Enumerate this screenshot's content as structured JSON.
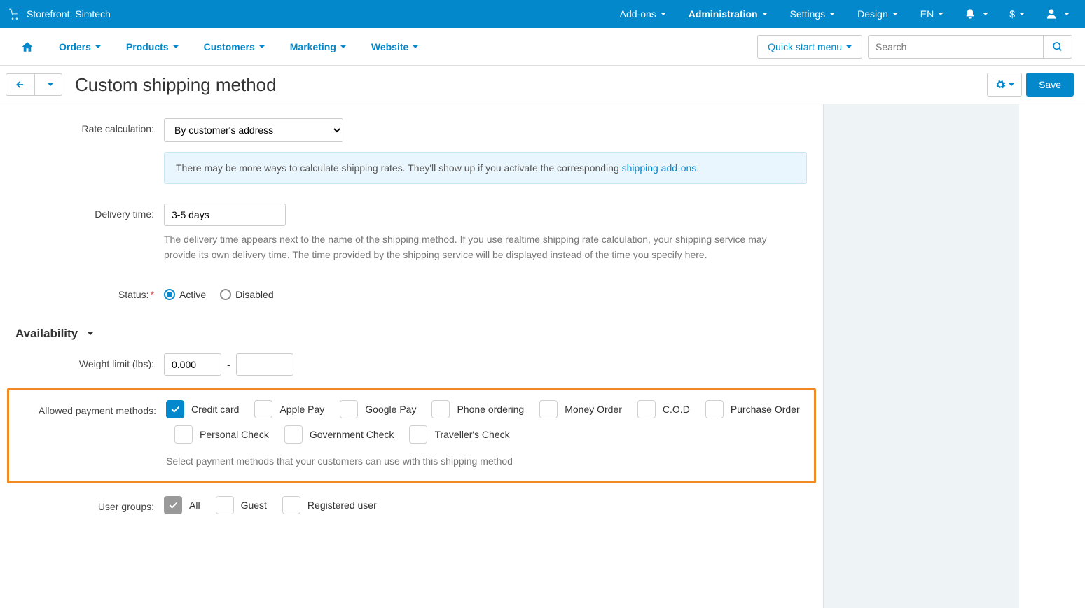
{
  "topbar": {
    "storefront": "Storefront: Simtech",
    "menu": [
      "Add-ons",
      "Administration",
      "Settings",
      "Design",
      "EN",
      "$"
    ]
  },
  "mainnav": {
    "items": [
      "Orders",
      "Products",
      "Customers",
      "Marketing",
      "Website"
    ],
    "quick_menu": "Quick start menu",
    "search_placeholder": "Search"
  },
  "page": {
    "title": "Custom shipping method",
    "save": "Save"
  },
  "form": {
    "rate_calc": {
      "label": "Rate calculation:",
      "value": "By customer's address",
      "info_prefix": "There may be more ways to calculate shipping rates. They'll show up if you activate the corresponding ",
      "info_link": "shipping add-ons",
      "info_suffix": "."
    },
    "delivery_time": {
      "label": "Delivery time:",
      "value": "3-5 days",
      "hint": "The delivery time appears next to the name of the shipping method. If you use realtime shipping rate calculation, your shipping service may provide its own delivery time. The time provided by the shipping service will be displayed instead of the time you specify here."
    },
    "status": {
      "label": "Status:",
      "active": "Active",
      "disabled": "Disabled"
    },
    "availability": "Availability",
    "weight_limit": {
      "label": "Weight limit (lbs):",
      "from": "0.000",
      "sep": "-",
      "to": ""
    },
    "payment_methods": {
      "label": "Allowed payment methods:",
      "options": [
        "Credit card",
        "Apple Pay",
        "Google Pay",
        "Phone ordering",
        "Money Order",
        "C.O.D",
        "Purchase Order",
        "Personal Check",
        "Government Check",
        "Traveller's Check"
      ],
      "hint": "Select payment methods that your customers can use with this shipping method"
    },
    "user_groups": {
      "label": "User groups:",
      "options": [
        "All",
        "Guest",
        "Registered user"
      ]
    }
  }
}
